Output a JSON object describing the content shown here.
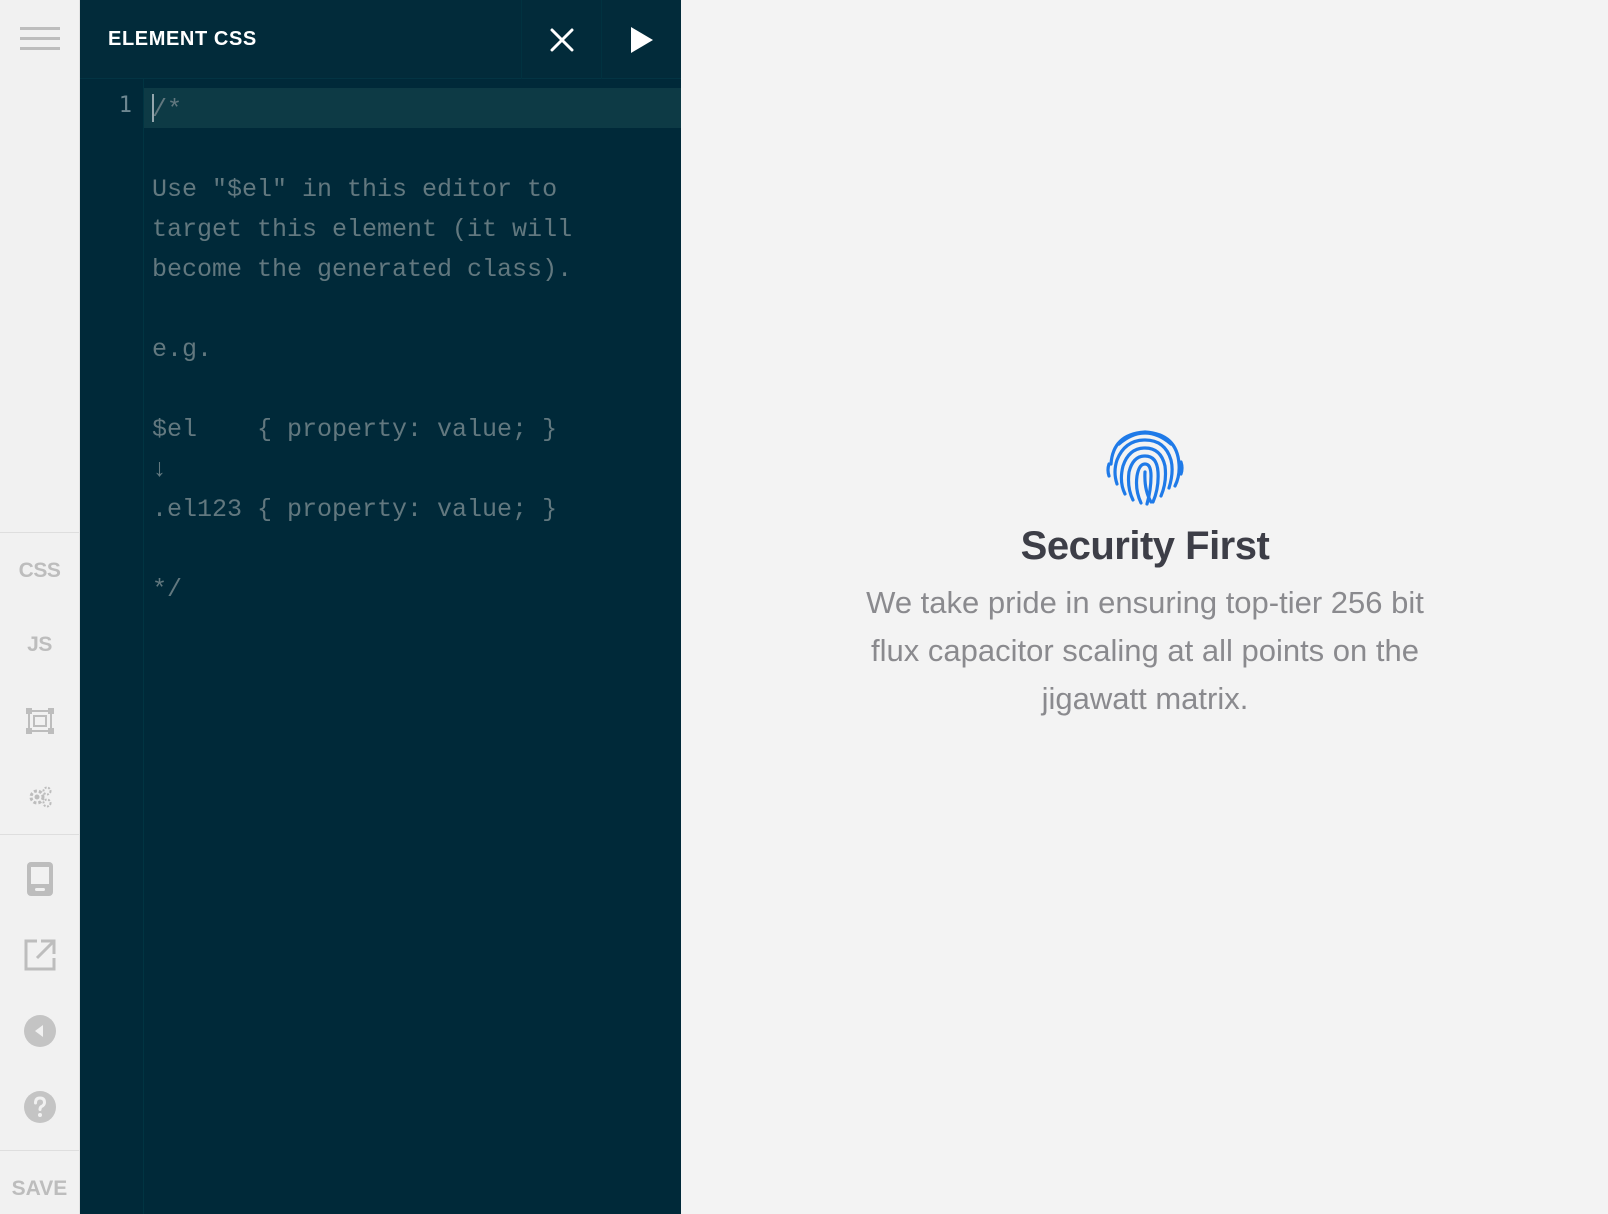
{
  "toolbar": {
    "menu_icon": "hamburger-menu-icon",
    "css_label": "CSS",
    "js_label": "JS",
    "layout_icon": "element-frame-icon",
    "settings_icon": "gears-icon",
    "device_icon": "device-preview-icon",
    "open_icon": "open-external-icon",
    "back_icon": "collapse-left-icon",
    "help_icon": "help-icon",
    "save_label": "SAVE"
  },
  "editor": {
    "title": "ELEMENT CSS",
    "close_icon": "close-icon",
    "run_icon": "play-icon",
    "line_number": "1",
    "code": "/*\n\nUse \"$el\" in this editor to\ntarget this element (it will\nbecome the generated class).\n\ne.g.\n\n$el    { property: value; }\n↓\n.el123 { property: value; }\n\n*/",
    "theme_colors": {
      "background": "#002939",
      "comment": "#62787f",
      "active_line": "#0d3a45"
    }
  },
  "preview": {
    "icon": "fingerprint-icon",
    "icon_color": "#1f7ae8",
    "title": "Security First",
    "description": "We take pride in ensuring top-tier 256 bit flux capacitor scaling at all points on the jigawatt matrix."
  }
}
